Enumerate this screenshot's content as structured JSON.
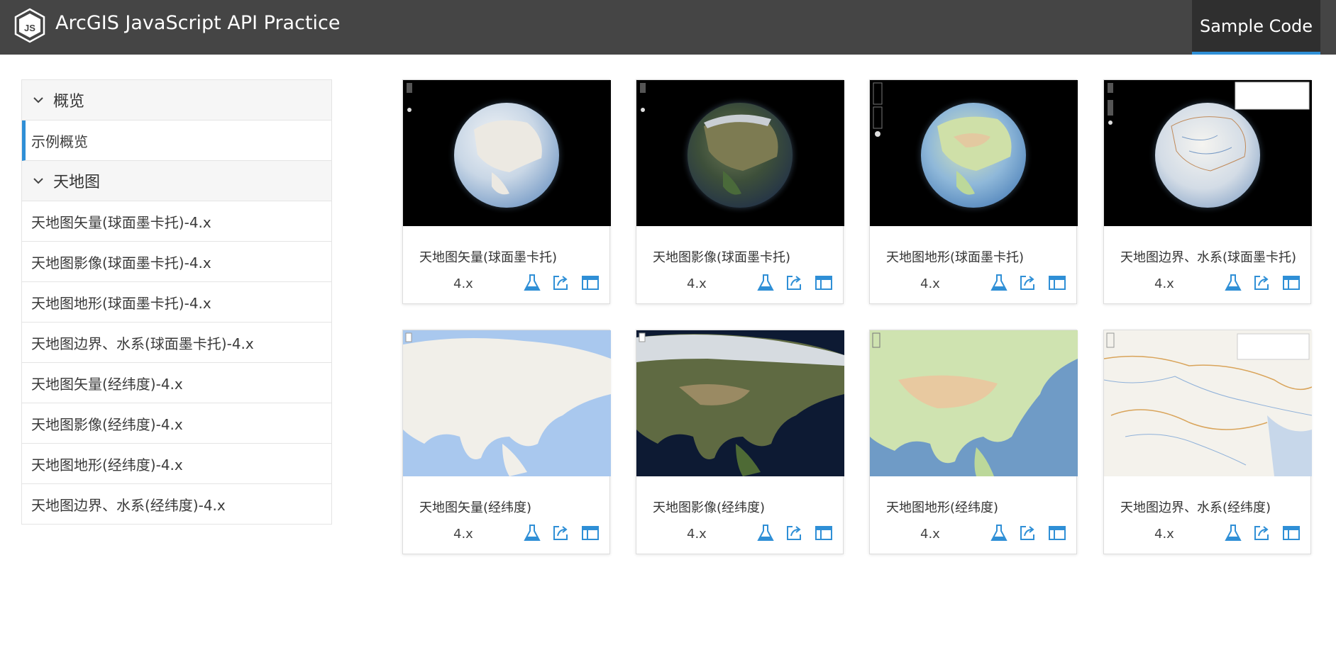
{
  "header": {
    "title": "ArcGIS JavaScript API Practice",
    "logo_text": "JS",
    "nav_sample_code": "Sample Code"
  },
  "sidebar": {
    "groups": [
      {
        "label": "概览",
        "items": [
          {
            "label": "示例概览",
            "active": true
          }
        ]
      },
      {
        "label": "天地图",
        "items": [
          {
            "label": "天地图矢量(球面墨卡托)-4.x"
          },
          {
            "label": "天地图影像(球面墨卡托)-4.x"
          },
          {
            "label": "天地图地形(球面墨卡托)-4.x"
          },
          {
            "label": "天地图边界、水系(球面墨卡托)-4.x"
          },
          {
            "label": "天地图矢量(经纬度)-4.x"
          },
          {
            "label": "天地图影像(经纬度)-4.x"
          },
          {
            "label": "天地图地形(经纬度)-4.x"
          },
          {
            "label": "天地图边界、水系(经纬度)-4.x"
          }
        ]
      }
    ]
  },
  "cards": [
    {
      "title": "天地图矢量(球面墨卡托)",
      "version": "4.x",
      "thumb": "globe-vector"
    },
    {
      "title": "天地图影像(球面墨卡托)",
      "version": "4.x",
      "thumb": "globe-imagery"
    },
    {
      "title": "天地图地形(球面墨卡托)",
      "version": "4.x",
      "thumb": "globe-terrain"
    },
    {
      "title": "天地图边界、水系(球面墨卡托)",
      "version": "4.x",
      "thumb": "globe-boundary"
    },
    {
      "title": "天地图矢量(经纬度)",
      "version": "4.x",
      "thumb": "map-vector"
    },
    {
      "title": "天地图影像(经纬度)",
      "version": "4.x",
      "thumb": "map-imagery"
    },
    {
      "title": "天地图地形(经纬度)",
      "version": "4.x",
      "thumb": "map-terrain"
    },
    {
      "title": "天地图边界、水系(经纬度)",
      "version": "4.x",
      "thumb": "map-boundary"
    }
  ],
  "card_icons": [
    "flask-icon",
    "share-icon",
    "window-icon"
  ],
  "colors": {
    "header_bg": "#454545",
    "accent": "#2f8fd6",
    "icon": "#2f8fd6"
  }
}
